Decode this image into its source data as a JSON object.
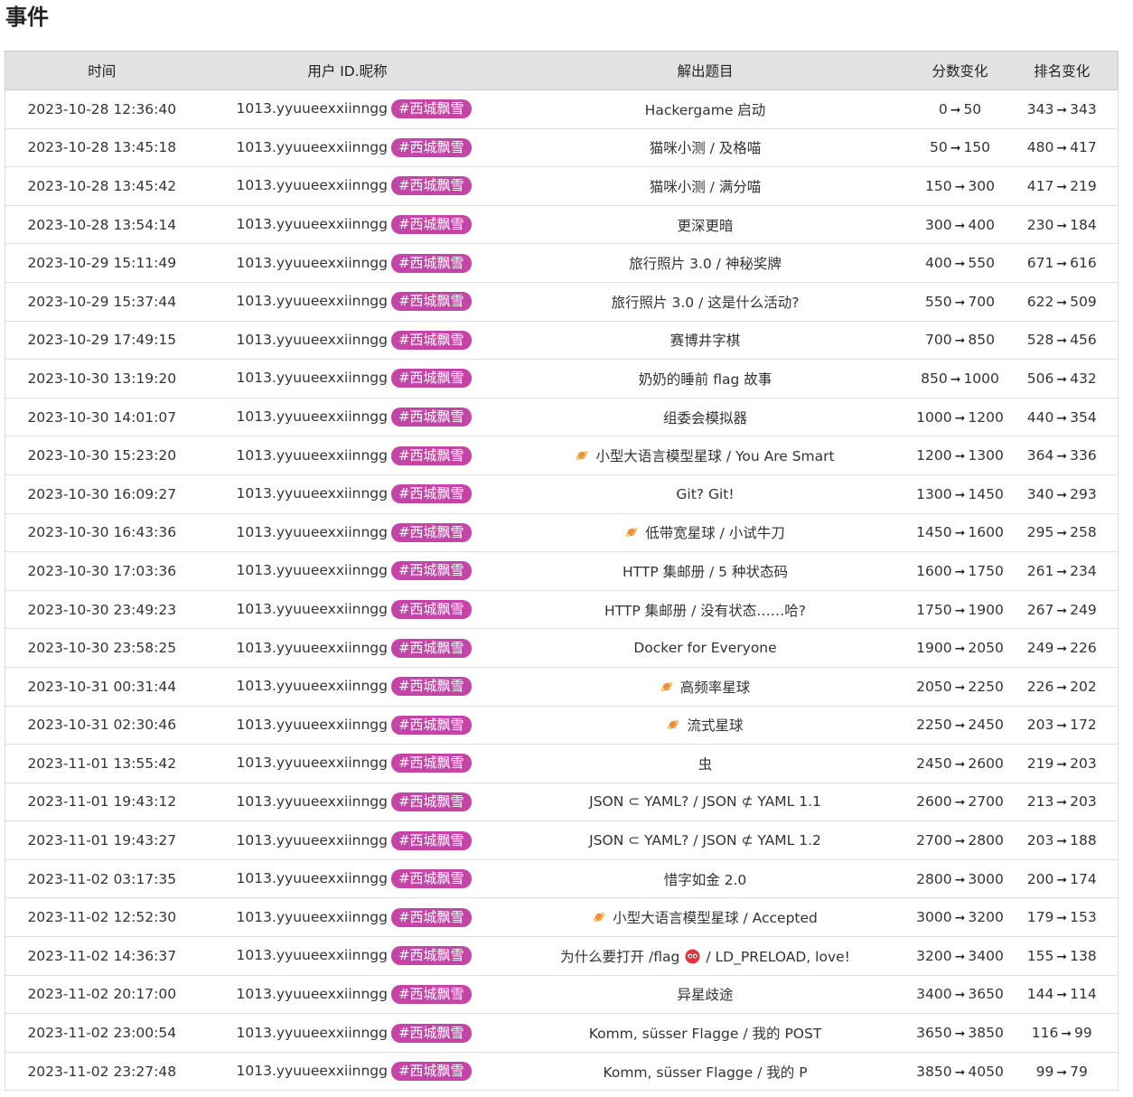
{
  "page": {
    "title": "事件"
  },
  "table": {
    "headers": {
      "time": "时间",
      "user": "用户 ID.昵称",
      "challenge": "解出题目",
      "score": "分数变化",
      "rank": "排名变化"
    },
    "arrow": "➞",
    "rows": [
      {
        "time": "2023-10-28 12:36:40",
        "uid": "1013.yyuueexxiinngg",
        "tag": "#西城飘雪",
        "challenge": "Hackergame 启动",
        "icon": "",
        "score_from": "0",
        "score_to": "50",
        "rank_from": "343",
        "rank_to": "343"
      },
      {
        "time": "2023-10-28 13:45:18",
        "uid": "1013.yyuueexxiinngg",
        "tag": "#西城飘雪",
        "challenge": "猫咪小测 / 及格喵",
        "icon": "",
        "score_from": "50",
        "score_to": "150",
        "rank_from": "480",
        "rank_to": "417"
      },
      {
        "time": "2023-10-28 13:45:42",
        "uid": "1013.yyuueexxiinngg",
        "tag": "#西城飘雪",
        "challenge": "猫咪小测 / 满分喵",
        "icon": "",
        "score_from": "150",
        "score_to": "300",
        "rank_from": "417",
        "rank_to": "219"
      },
      {
        "time": "2023-10-28 13:54:14",
        "uid": "1013.yyuueexxiinngg",
        "tag": "#西城飘雪",
        "challenge": "更深更暗",
        "icon": "",
        "score_from": "300",
        "score_to": "400",
        "rank_from": "230",
        "rank_to": "184"
      },
      {
        "time": "2023-10-29 15:11:49",
        "uid": "1013.yyuueexxiinngg",
        "tag": "#西城飘雪",
        "challenge": "旅行照片 3.0 / 神秘奖牌",
        "icon": "",
        "score_from": "400",
        "score_to": "550",
        "rank_from": "671",
        "rank_to": "616"
      },
      {
        "time": "2023-10-29 15:37:44",
        "uid": "1013.yyuueexxiinngg",
        "tag": "#西城飘雪",
        "challenge": "旅行照片 3.0 / 这是什么活动?",
        "icon": "",
        "score_from": "550",
        "score_to": "700",
        "rank_from": "622",
        "rank_to": "509"
      },
      {
        "time": "2023-10-29 17:49:15",
        "uid": "1013.yyuueexxiinngg",
        "tag": "#西城飘雪",
        "challenge": "赛博井字棋",
        "icon": "",
        "score_from": "700",
        "score_to": "850",
        "rank_from": "528",
        "rank_to": "456"
      },
      {
        "time": "2023-10-30 13:19:20",
        "uid": "1013.yyuueexxiinngg",
        "tag": "#西城飘雪",
        "challenge": "奶奶的睡前 flag 故事",
        "icon": "",
        "score_from": "850",
        "score_to": "1000",
        "rank_from": "506",
        "rank_to": "432"
      },
      {
        "time": "2023-10-30 14:01:07",
        "uid": "1013.yyuueexxiinngg",
        "tag": "#西城飘雪",
        "challenge": "组委会模拟器",
        "icon": "",
        "score_from": "1000",
        "score_to": "1200",
        "rank_from": "440",
        "rank_to": "354"
      },
      {
        "time": "2023-10-30 15:23:20",
        "uid": "1013.yyuueexxiinngg",
        "tag": "#西城飘雪",
        "challenge": "小型大语言模型星球 / You Are Smart",
        "icon": "planet-icon",
        "score_from": "1200",
        "score_to": "1300",
        "rank_from": "364",
        "rank_to": "336"
      },
      {
        "time": "2023-10-30 16:09:27",
        "uid": "1013.yyuueexxiinngg",
        "tag": "#西城飘雪",
        "challenge": "Git? Git!",
        "icon": "",
        "score_from": "1300",
        "score_to": "1450",
        "rank_from": "340",
        "rank_to": "293"
      },
      {
        "time": "2023-10-30 16:43:36",
        "uid": "1013.yyuueexxiinngg",
        "tag": "#西城飘雪",
        "challenge": "低带宽星球 / 小试牛刀",
        "icon": "planet-icon",
        "score_from": "1450",
        "score_to": "1600",
        "rank_from": "295",
        "rank_to": "258"
      },
      {
        "time": "2023-10-30 17:03:36",
        "uid": "1013.yyuueexxiinngg",
        "tag": "#西城飘雪",
        "challenge": "HTTP 集邮册 / 5 种状态码",
        "icon": "",
        "score_from": "1600",
        "score_to": "1750",
        "rank_from": "261",
        "rank_to": "234"
      },
      {
        "time": "2023-10-30 23:49:23",
        "uid": "1013.yyuueexxiinngg",
        "tag": "#西城飘雪",
        "challenge": "HTTP 集邮册 / 没有状态……哈?",
        "icon": "",
        "score_from": "1750",
        "score_to": "1900",
        "rank_from": "267",
        "rank_to": "249"
      },
      {
        "time": "2023-10-30 23:58:25",
        "uid": "1013.yyuueexxiinngg",
        "tag": "#西城飘雪",
        "challenge": "Docker for Everyone",
        "icon": "",
        "score_from": "1900",
        "score_to": "2050",
        "rank_from": "249",
        "rank_to": "226"
      },
      {
        "time": "2023-10-31 00:31:44",
        "uid": "1013.yyuueexxiinngg",
        "tag": "#西城飘雪",
        "challenge": "高频率星球",
        "icon": "planet-icon",
        "score_from": "2050",
        "score_to": "2250",
        "rank_from": "226",
        "rank_to": "202"
      },
      {
        "time": "2023-10-31 02:30:46",
        "uid": "1013.yyuueexxiinngg",
        "tag": "#西城飘雪",
        "challenge": "流式星球",
        "icon": "planet-icon",
        "score_from": "2250",
        "score_to": "2450",
        "rank_from": "203",
        "rank_to": "172"
      },
      {
        "time": "2023-11-01 13:55:42",
        "uid": "1013.yyuueexxiinngg",
        "tag": "#西城飘雪",
        "challenge": "虫",
        "icon": "",
        "score_from": "2450",
        "score_to": "2600",
        "rank_from": "219",
        "rank_to": "203"
      },
      {
        "time": "2023-11-01 19:43:12",
        "uid": "1013.yyuueexxiinngg",
        "tag": "#西城飘雪",
        "challenge": "JSON ⊂ YAML? / JSON ⊄ YAML 1.1",
        "icon": "",
        "score_from": "2600",
        "score_to": "2700",
        "rank_from": "213",
        "rank_to": "203"
      },
      {
        "time": "2023-11-01 19:43:27",
        "uid": "1013.yyuueexxiinngg",
        "tag": "#西城飘雪",
        "challenge": "JSON ⊂ YAML? / JSON ⊄ YAML 1.2",
        "icon": "",
        "score_from": "2700",
        "score_to": "2800",
        "rank_from": "203",
        "rank_to": "188"
      },
      {
        "time": "2023-11-02 03:17:35",
        "uid": "1013.yyuueexxiinngg",
        "tag": "#西城飘雪",
        "challenge": "惜字如金 2.0",
        "icon": "",
        "score_from": "2800",
        "score_to": "3000",
        "rank_from": "200",
        "rank_to": "174"
      },
      {
        "time": "2023-11-02 12:52:30",
        "uid": "1013.yyuueexxiinngg",
        "tag": "#西城飘雪",
        "challenge": "小型大语言模型星球 / Accepted",
        "icon": "planet-icon",
        "score_from": "3000",
        "score_to": "3200",
        "rank_from": "179",
        "rank_to": "153"
      },
      {
        "time": "2023-11-02 14:36:37",
        "uid": "1013.yyuueexxiinngg",
        "tag": "#西城飘雪",
        "challenge": "为什么要打开 /flag",
        "challenge_suffix": "/ LD_PRELOAD, love!",
        "icon": "bug-icon",
        "score_from": "3200",
        "score_to": "3400",
        "rank_from": "155",
        "rank_to": "138"
      },
      {
        "time": "2023-11-02 20:17:00",
        "uid": "1013.yyuueexxiinngg",
        "tag": "#西城飘雪",
        "challenge": "异星歧途",
        "icon": "",
        "score_from": "3400",
        "score_to": "3650",
        "rank_from": "144",
        "rank_to": "114"
      },
      {
        "time": "2023-11-02 23:00:54",
        "uid": "1013.yyuueexxiinngg",
        "tag": "#西城飘雪",
        "challenge": "Komm, süsser Flagge / 我的 POST",
        "icon": "",
        "score_from": "3650",
        "score_to": "3850",
        "rank_from": "116",
        "rank_to": "99"
      },
      {
        "time": "2023-11-02 23:27:48",
        "uid": "1013.yyuueexxiinngg",
        "tag": "#西城飘雪",
        "challenge": "Komm, süsser Flagge / 我的 P",
        "icon": "",
        "score_from": "3850",
        "score_to": "4050",
        "rank_from": "99",
        "rank_to": "79"
      }
    ]
  },
  "colors": {
    "tag_bg": "#c445a7",
    "header_bg": "#e2e2e2"
  }
}
